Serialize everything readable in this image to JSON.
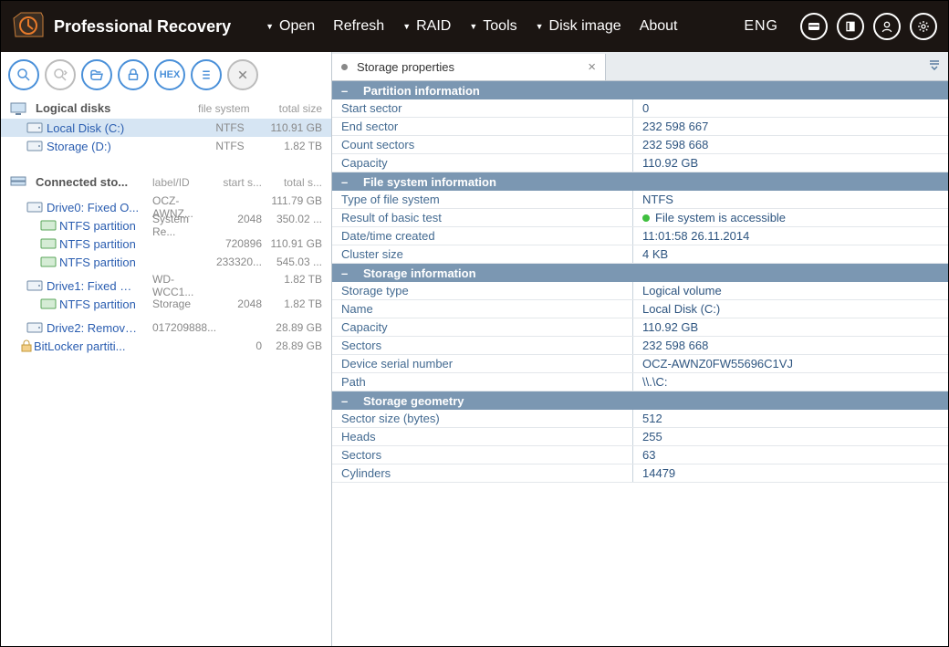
{
  "app_title": "Professional Recovery",
  "menu": {
    "open": "Open",
    "refresh": "Refresh",
    "raid": "RAID",
    "tools": "Tools",
    "disk_image": "Disk image",
    "about": "About"
  },
  "lang": "ENG",
  "logical": {
    "header": "Logical disks",
    "col_fs": "file system",
    "col_size": "total size",
    "items": [
      {
        "name": "Local Disk (C:)",
        "fs": "NTFS",
        "size": "110.91 GB"
      },
      {
        "name": "Storage (D:)",
        "fs": "NTFS",
        "size": "1.82 TB"
      }
    ]
  },
  "connected": {
    "header": "Connected sto...",
    "col_label": "label/ID",
    "col_start": "start s...",
    "col_size": "total s...",
    "drives": [
      {
        "name": "Drive0: Fixed O...",
        "label": "OCZ-AWNZ...",
        "start": "",
        "size": "111.79 GB",
        "parts": [
          {
            "name": "NTFS partition",
            "label": "System Re...",
            "start": "2048",
            "size": "350.02 ..."
          },
          {
            "name": "NTFS partition",
            "label": "",
            "start": "720896",
            "size": "110.91 GB"
          },
          {
            "name": "NTFS partition",
            "label": "",
            "start": "233320...",
            "size": "545.03 ..."
          }
        ]
      },
      {
        "name": "Drive1: Fixed W...",
        "label": "WD-WCC1...",
        "start": "",
        "size": "1.82 TB",
        "parts": [
          {
            "name": "NTFS partition",
            "label": "Storage",
            "start": "2048",
            "size": "1.82 TB"
          }
        ]
      },
      {
        "name": "Drive2: Remova...",
        "label": "017209888...",
        "start": "",
        "size": "28.89 GB",
        "parts": [
          {
            "name": "BitLocker partiti...",
            "label": "",
            "start": "0",
            "size": "28.89 GB",
            "bitlocker": true
          }
        ]
      }
    ]
  },
  "tab_title": "Storage properties",
  "groups": [
    {
      "title": "Partition information",
      "rows": [
        {
          "k": "Start sector",
          "v": "0"
        },
        {
          "k": "End sector",
          "v": "232 598 667"
        },
        {
          "k": "Count sectors",
          "v": "232 598 668"
        },
        {
          "k": "Capacity",
          "v": "110.92 GB"
        }
      ]
    },
    {
      "title": "File system information",
      "rows": [
        {
          "k": "Type of file system",
          "v": "NTFS"
        },
        {
          "k": "Result of basic test",
          "v": "File system is accessible",
          "status": true
        },
        {
          "k": "Date/time created",
          "v": "11:01:58 26.11.2014"
        },
        {
          "k": "Cluster size",
          "v": "4 KB"
        }
      ]
    },
    {
      "title": "Storage information",
      "rows": [
        {
          "k": "Storage type",
          "v": "Logical volume"
        },
        {
          "k": "Name",
          "v": "Local Disk (C:)"
        },
        {
          "k": "Capacity",
          "v": "110.92 GB"
        },
        {
          "k": "Sectors",
          "v": "232 598 668"
        },
        {
          "k": "Device serial number",
          "v": "OCZ-AWNZ0FW55696C1VJ"
        },
        {
          "k": "Path",
          "v": "\\\\.\\C:"
        }
      ]
    },
    {
      "title": "Storage geometry",
      "rows": [
        {
          "k": "Sector size (bytes)",
          "v": "512"
        },
        {
          "k": "Heads",
          "v": "255"
        },
        {
          "k": "Sectors",
          "v": "63"
        },
        {
          "k": "Cylinders",
          "v": "14479"
        }
      ]
    }
  ]
}
